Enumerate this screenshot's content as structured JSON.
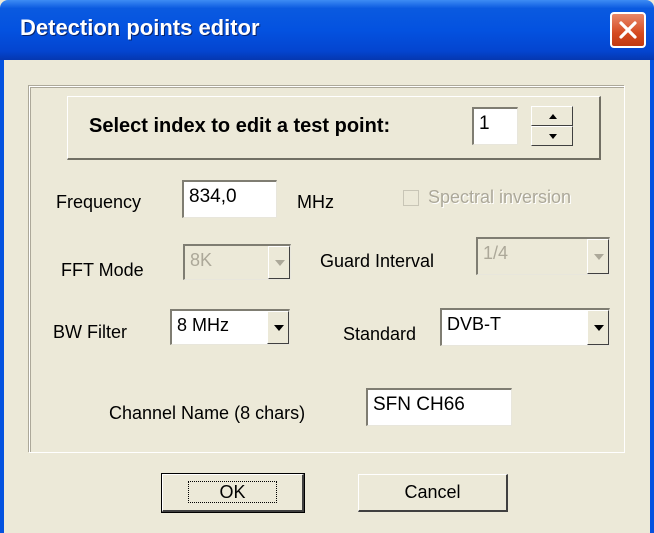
{
  "window": {
    "title": "Detection points editor"
  },
  "index": {
    "label": "Select index to edit a test point:",
    "value": "1"
  },
  "frequency": {
    "label": "Frequency",
    "value": "834,0",
    "unit": "MHz"
  },
  "spectral_inversion": {
    "label": "Spectral inversion",
    "checked": false,
    "enabled": false
  },
  "fft_mode": {
    "label": "FFT Mode",
    "value": "8K",
    "enabled": false
  },
  "guard_interval": {
    "label": "Guard Interval",
    "value": "1/4",
    "enabled": false
  },
  "bw_filter": {
    "label": "BW Filter",
    "value": "8 MHz"
  },
  "standard": {
    "label": "Standard",
    "value": "DVB-T"
  },
  "channel_name": {
    "label": "Channel Name (8 chars)",
    "value": "SFN CH66"
  },
  "buttons": {
    "ok": "OK",
    "cancel": "Cancel"
  },
  "icons": {
    "close": "close-icon",
    "spin_up": "arrow-up-icon",
    "spin_down": "arrow-down-icon",
    "dropdown": "chevron-down-icon"
  }
}
